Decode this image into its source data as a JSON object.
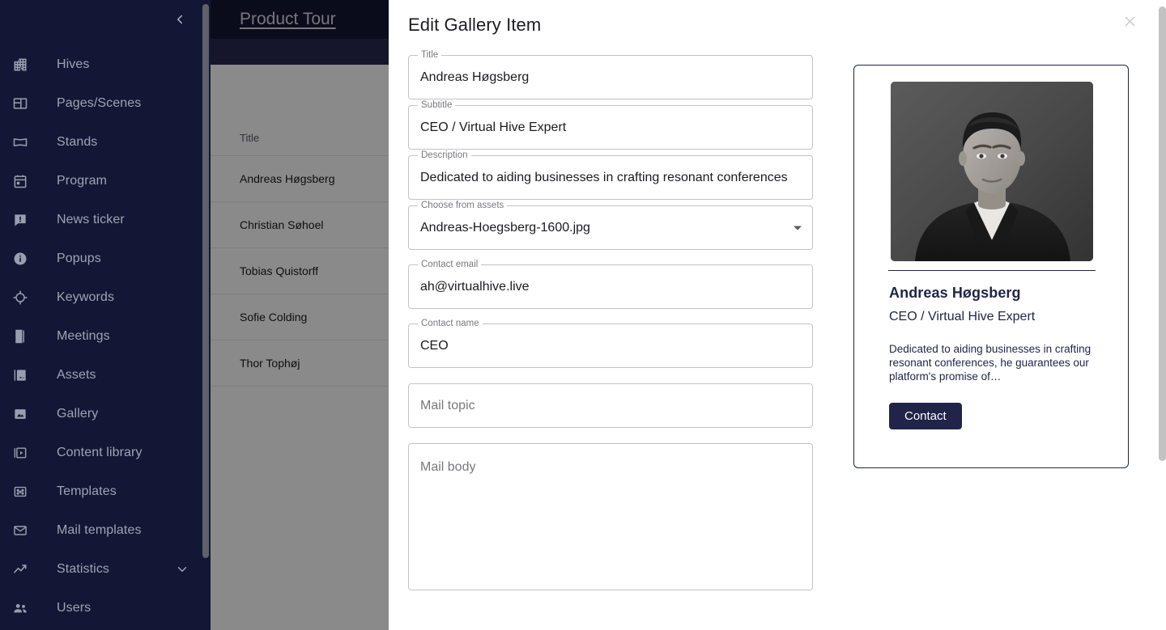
{
  "sidebar": {
    "collapse_icon": "chevron-left-icon",
    "items": [
      {
        "label": "Hives",
        "icon": "building-icon"
      },
      {
        "label": "Pages/Scenes",
        "icon": "layout-icon"
      },
      {
        "label": "Stands",
        "icon": "stand-icon"
      },
      {
        "label": "Program",
        "icon": "calendar-icon"
      },
      {
        "label": "News ticker",
        "icon": "announcement-icon"
      },
      {
        "label": "Popups",
        "icon": "info-circle-icon"
      },
      {
        "label": "Keywords",
        "icon": "target-icon"
      },
      {
        "label": "Meetings",
        "icon": "door-icon"
      },
      {
        "label": "Assets",
        "icon": "images-icon"
      },
      {
        "label": "Gallery",
        "icon": "image-icon"
      },
      {
        "label": "Content library",
        "icon": "video-library-icon"
      },
      {
        "label": "Templates",
        "icon": "template-icon"
      },
      {
        "label": "Mail templates",
        "icon": "envelope-icon"
      },
      {
        "label": "Statistics",
        "icon": "trending-up-icon",
        "expandable": true
      },
      {
        "label": "Users",
        "icon": "users-icon"
      }
    ]
  },
  "page": {
    "title": "Product Tour",
    "table": {
      "columns": [
        "Title"
      ],
      "rows": [
        [
          "Andreas Høgsberg"
        ],
        [
          "Christian Søhoel"
        ],
        [
          "Tobias Quistorff"
        ],
        [
          "Sofie Colding"
        ],
        [
          "Thor Tophøj"
        ]
      ]
    }
  },
  "modal": {
    "title": "Edit Gallery Item",
    "close_icon": "close-icon",
    "fields": [
      {
        "name": "title",
        "label": "Title",
        "value": "Andreas Høgsberg",
        "placeholder": "",
        "type": "text"
      },
      {
        "name": "subtitle",
        "label": "Subtitle",
        "value": "CEO / Virtual Hive Expert",
        "placeholder": "",
        "type": "text"
      },
      {
        "name": "description",
        "label": "Description",
        "value": "Dedicated to aiding businesses in crafting resonant conferences,",
        "placeholder": "",
        "type": "text"
      },
      {
        "name": "asset",
        "label": "Choose from assets",
        "value": "Andreas-Hoegsberg-1600.jpg",
        "placeholder": "",
        "type": "select"
      },
      {
        "name": "contact_email",
        "label": "Contact email",
        "value": "ah@virtualhive.live",
        "placeholder": "",
        "type": "text"
      },
      {
        "name": "contact_name",
        "label": "Contact name",
        "value": "CEO",
        "placeholder": "",
        "type": "text"
      },
      {
        "name": "mail_topic",
        "label": "",
        "value": "",
        "placeholder": "Mail topic",
        "type": "text"
      },
      {
        "name": "mail_body",
        "label": "",
        "value": "",
        "placeholder": "Mail body",
        "type": "textarea"
      }
    ]
  },
  "preview": {
    "photo_alt": "portrait-photo",
    "name": "Andreas Høgsberg",
    "subtitle": "CEO / Virtual Hive Expert",
    "description": "Dedicated to aiding businesses in crafting resonant conferences, he guarantees our platform's promise of…",
    "contact_button": "Contact"
  },
  "colors": {
    "sidebar_bg": "#131735",
    "header_bg": "#131735",
    "subbar_bg": "#282a52",
    "accent_navy": "#1f2448",
    "nav_text": "#9fa3b4",
    "field_border": "#c3c3c7"
  }
}
